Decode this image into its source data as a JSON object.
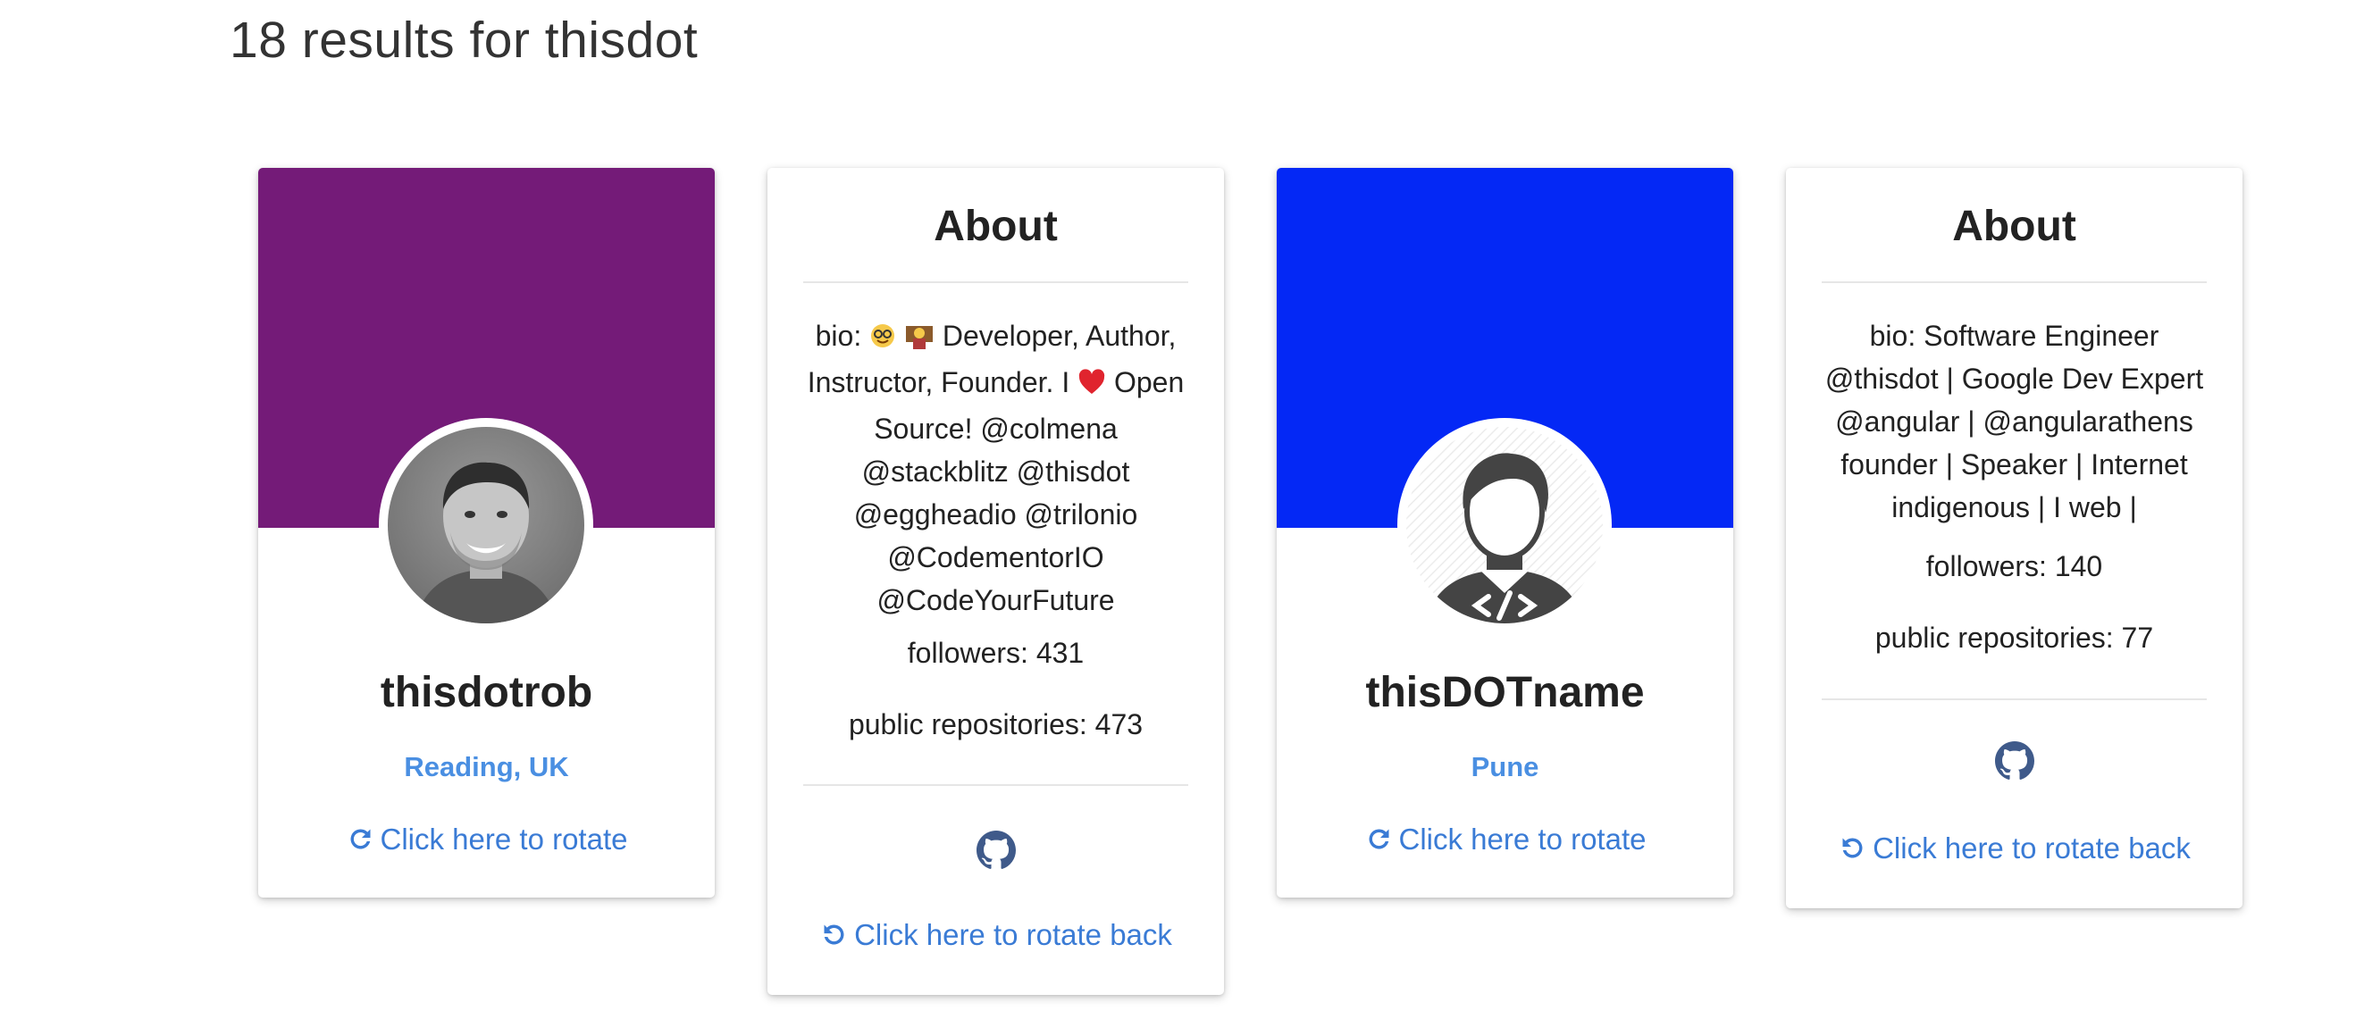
{
  "results_title": "18 results for thisdot",
  "rotate_label": "Click here to rotate",
  "rotate_back_label": "Click here to rotate back",
  "about_title": "About",
  "colors": {
    "purple_banner": "#741b78",
    "blue_banner": "#0428f5",
    "link_blue": "#3a7bd5",
    "location_blue": "#4a8fe2",
    "github_icon": "#3f5a8a"
  },
  "cards": [
    {
      "front": {
        "username": "thisdotrob",
        "location": "Reading, UK",
        "avatar": "person-photo-icon"
      },
      "back": {
        "bio_prefix": "bio:",
        "bio_text": "Developer, Author, Instructor, Founder. I",
        "bio_suffix": "Open Source! @colmena @stackblitz @thisdot @eggheadio @trilonio @CodementorIO @CodeYourFuture",
        "followers": "followers: 431",
        "repos": "public repositories: 473"
      }
    },
    {
      "front": {
        "username": "thisDOTname",
        "location": "Pune",
        "avatar": "developer-avatar-icon"
      },
      "back": {
        "bio": "bio: Software Engineer @thisdot | Google Dev Expert @angular | @angularathens founder | Speaker | Internet indigenous | I web |",
        "followers": "followers: 140",
        "repos": "public repositories: 77"
      }
    }
  ]
}
